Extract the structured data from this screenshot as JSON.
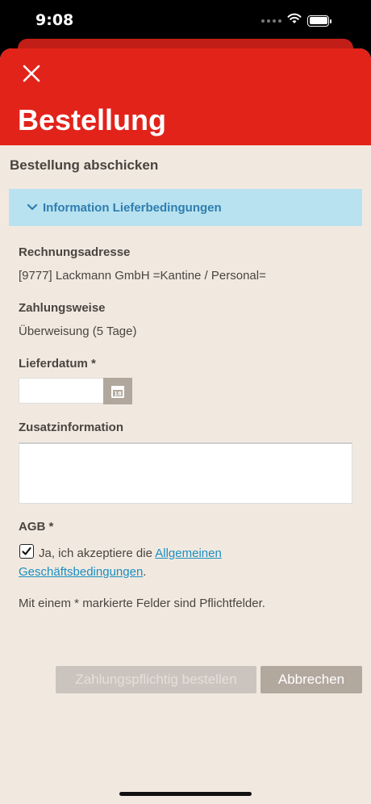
{
  "status_bar": {
    "time": "9:08",
    "icons": [
      "signal-icon",
      "wifi-icon",
      "battery-icon"
    ]
  },
  "header": {
    "title": "Bestellung",
    "close_icon": "close-icon"
  },
  "form": {
    "section_title": "Bestellung abschicken",
    "info_toggle": "Information Lieferbedingungen",
    "billing_label": "Rechnungsadresse",
    "billing_value": "[9777] Lackmann GmbH =Kantine / Personal=",
    "payment_label": "Zahlungsweise",
    "payment_value": "Überweisung (5 Tage)",
    "delivery_label": "Lieferdatum *",
    "delivery_value": "",
    "calendar_day": "18",
    "extra_label": "Zusatzinformation",
    "extra_value": "",
    "agb_label": "AGB *",
    "agb_text_before": "Ja, ich akzeptiere die ",
    "agb_link": "Allgemeinen Geschäftsbedingungen",
    "agb_text_after": ".",
    "agb_checked": true,
    "required_note": "Mit einem * markierte Felder sind Pflichtfelder."
  },
  "actions": {
    "order_label": "Zahlungspflichtig bestellen",
    "cancel_label": "Abbrechen"
  },
  "colors": {
    "brand_red": "#e2231a",
    "background": "#f1e9e0",
    "info_bg": "#b8e2f0",
    "info_text": "#2f7db0",
    "link": "#1a8fc2"
  }
}
